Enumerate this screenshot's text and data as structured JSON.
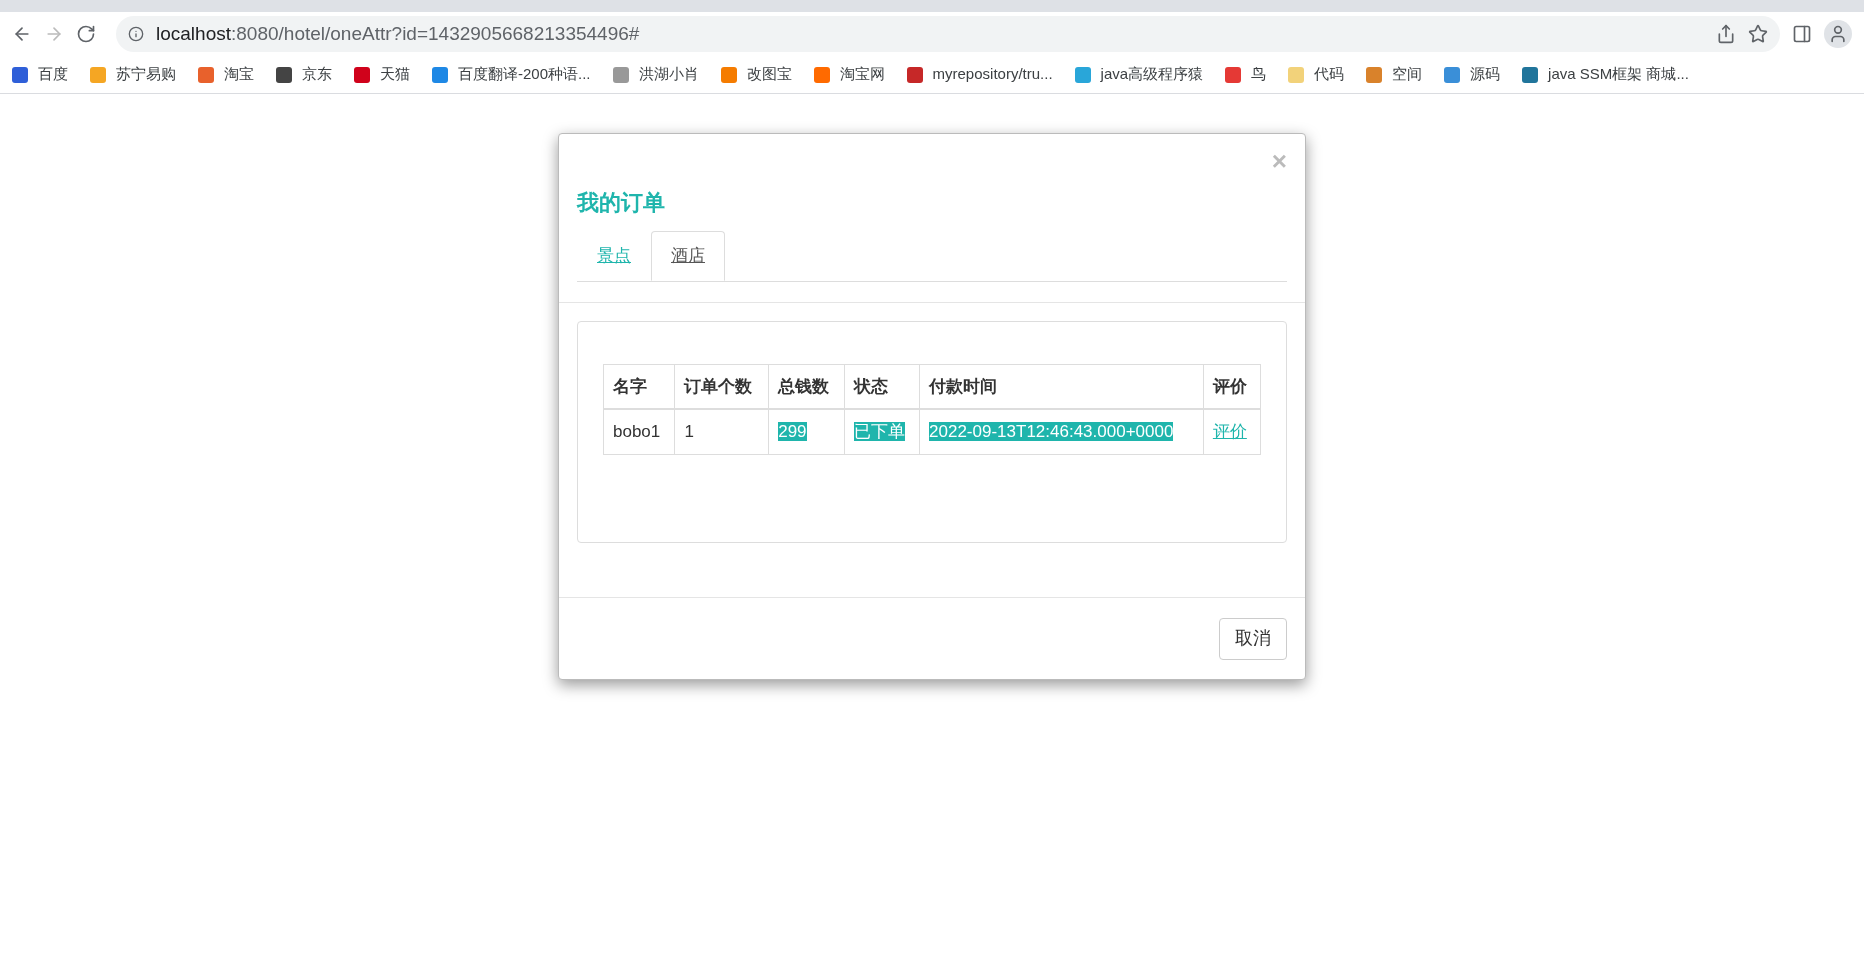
{
  "browser": {
    "url_host": "localhost",
    "url_rest": ":8080/hotel/oneAttr?id=1432905668213354496#"
  },
  "bookmarks": [
    "百度",
    "苏宁易购",
    "淘宝",
    "京东",
    "天猫",
    "百度翻译-200种语...",
    "洪湖小肖",
    "改图宝",
    "淘宝网",
    "myrepository/tru...",
    "java高级程序猿",
    "鸟",
    "代码",
    "空间",
    "源码",
    "java SSM框架 商城..."
  ],
  "modal": {
    "close": "×",
    "title": "我的订单",
    "tabs": [
      {
        "label": "景点",
        "selected": false
      },
      {
        "label": "酒店",
        "selected": true
      }
    ],
    "table": {
      "columns": [
        "名字",
        "订单个数",
        "总钱数",
        "状态",
        "付款时间",
        "评价"
      ],
      "rows": [
        [
          {
            "text": "bobo1",
            "kind": "plain"
          },
          {
            "text": "1",
            "kind": "plain"
          },
          {
            "text": "299",
            "kind": "highlighted"
          },
          {
            "text": "已下单",
            "kind": "highlighted"
          },
          {
            "text": "2022-09-13T12:46:43.000+0000",
            "kind": "highlighted"
          },
          {
            "text": "评价",
            "kind": "link"
          }
        ]
      ]
    },
    "buttons": [
      "取消"
    ]
  }
}
